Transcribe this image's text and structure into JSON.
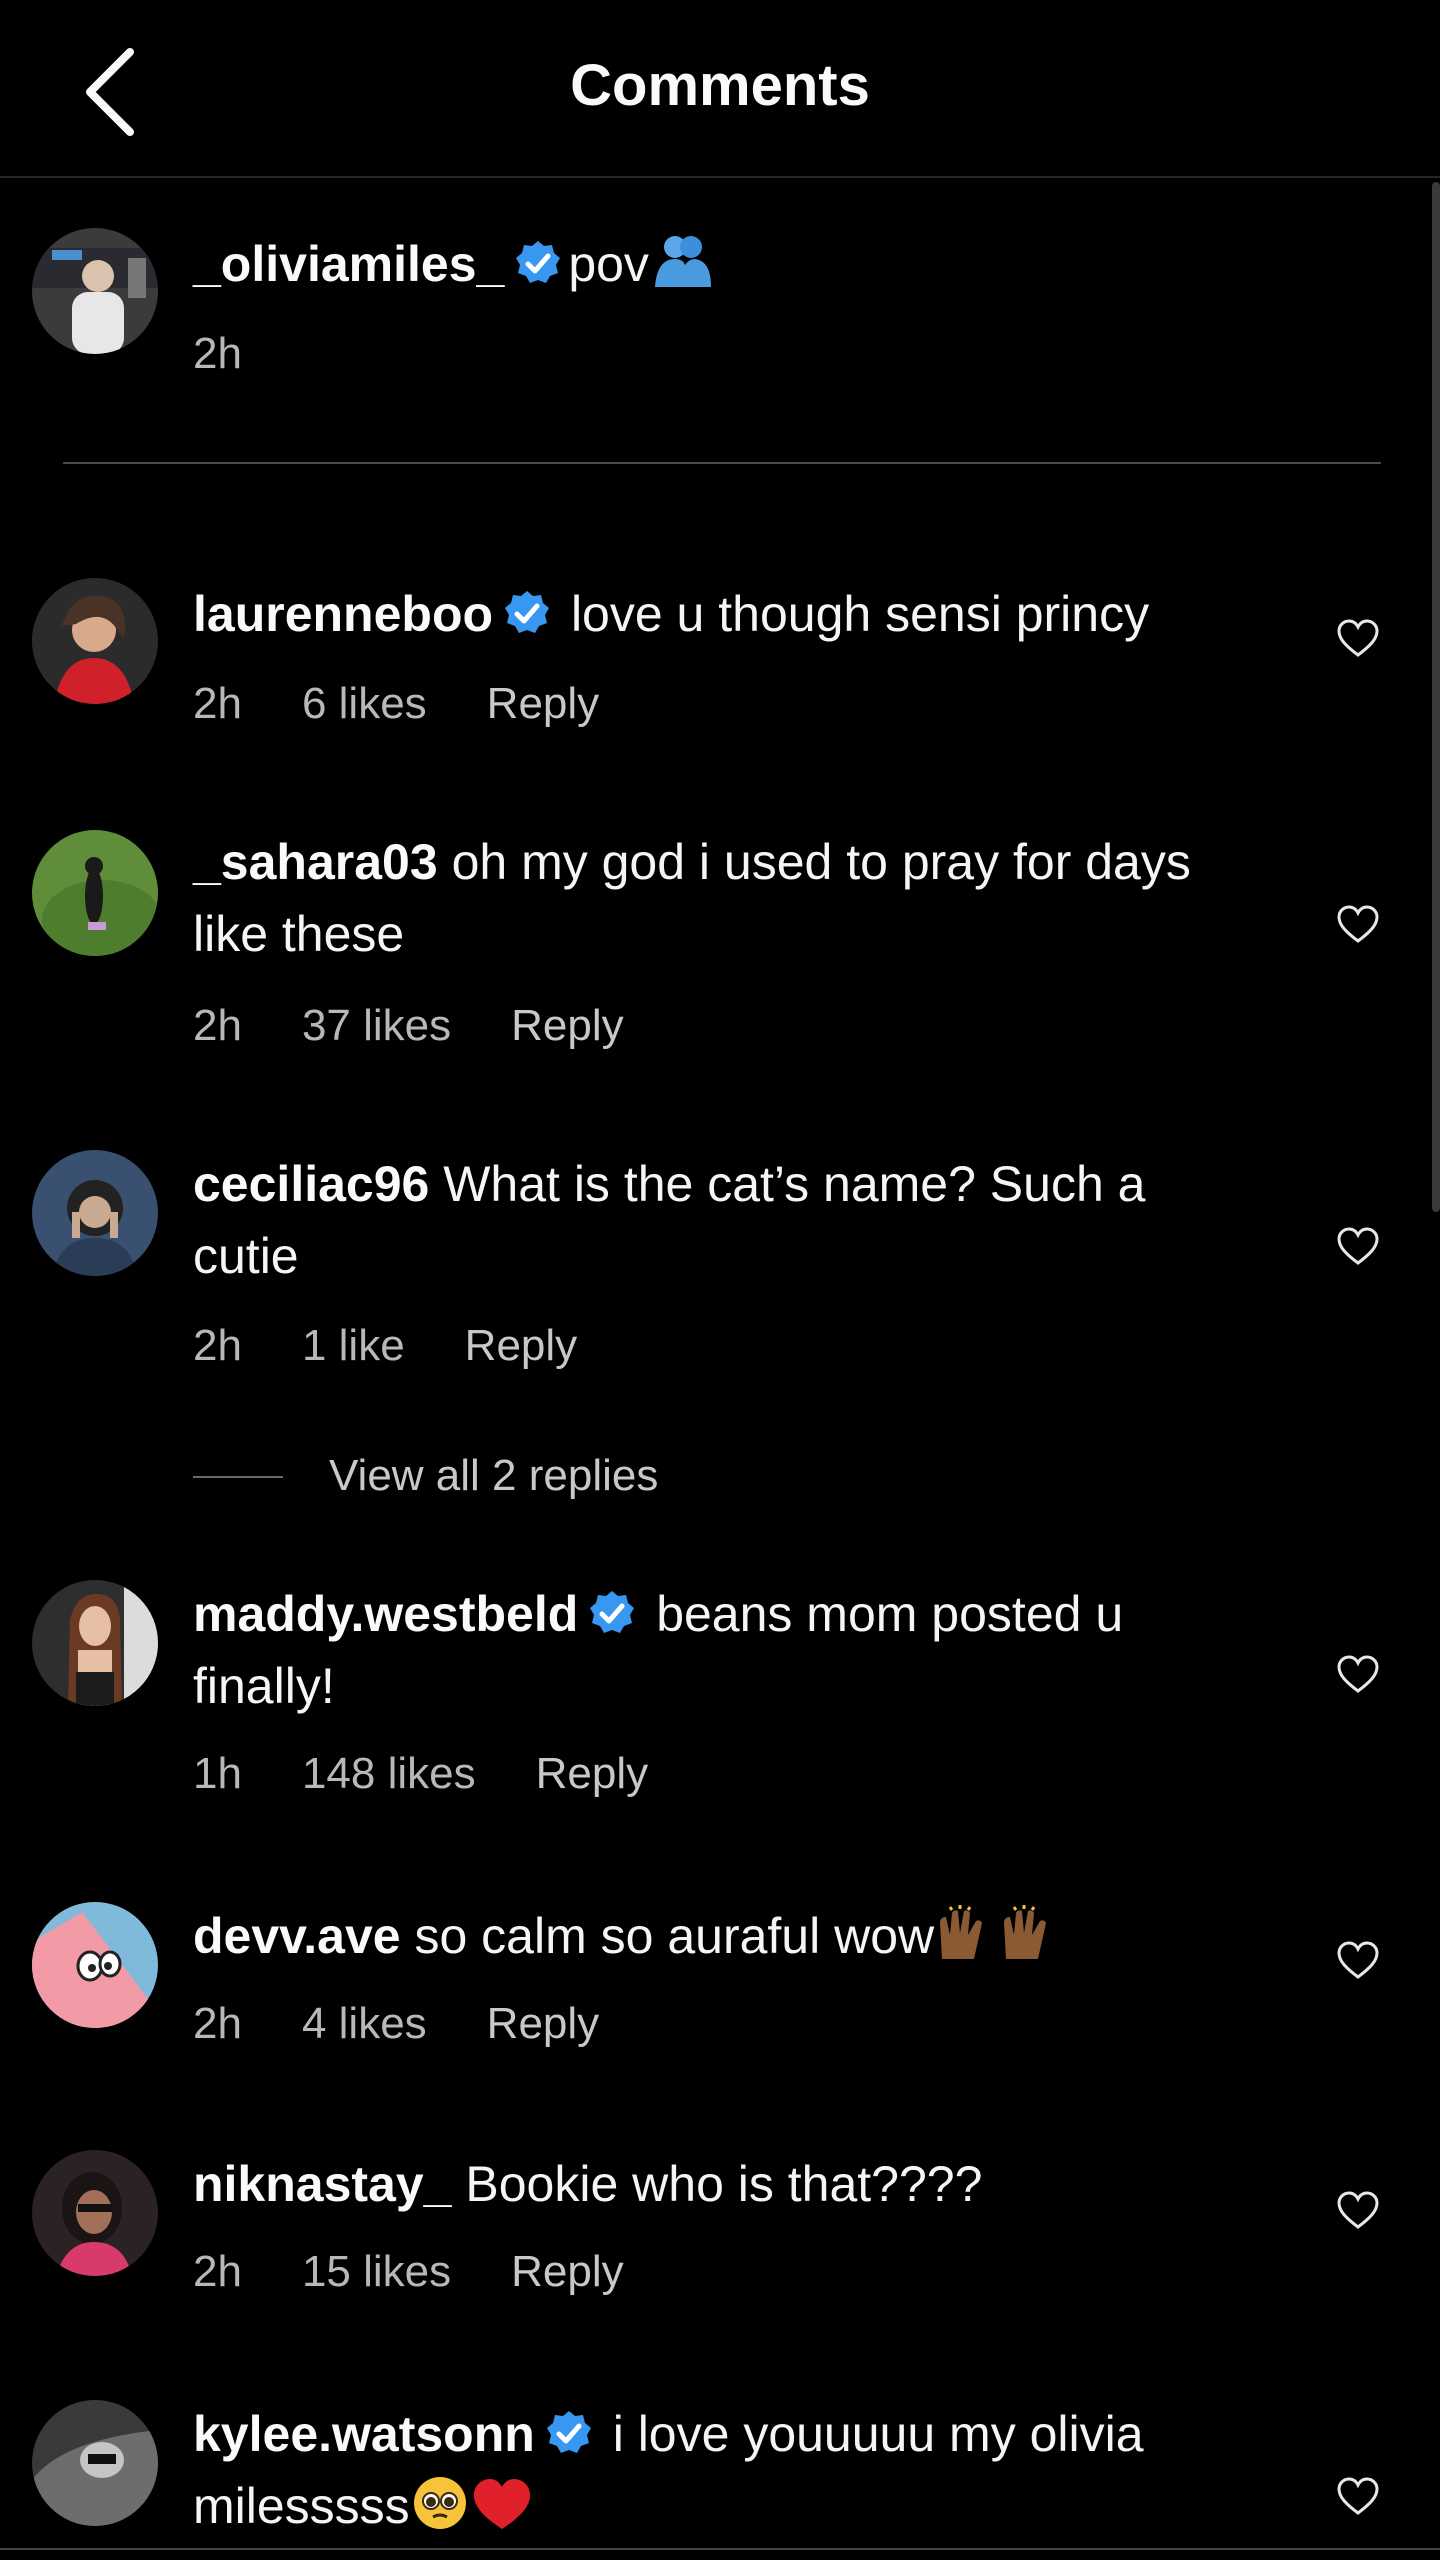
{
  "header": {
    "title": "Comments",
    "back_icon": "chevron-left-icon"
  },
  "caption": {
    "username": "_oliviamiles_",
    "verified": true,
    "text": "pov",
    "emoji_icon": "blue-hug-emoji",
    "time": "2h"
  },
  "comments": [
    {
      "username": "laurenneboo",
      "verified": true,
      "text": "love u though sensi princy",
      "time": "2h",
      "likes": "6 likes",
      "reply": "Reply"
    },
    {
      "username": "_sahara03",
      "verified": false,
      "text": "oh my god i used to pray for days like these",
      "time": "2h",
      "likes": "37 likes",
      "reply": "Reply"
    },
    {
      "username": "ceciliac96",
      "verified": false,
      "text": "What is the cat’s name? Such a cutie",
      "time": "2h",
      "likes": "1 like",
      "reply": "Reply",
      "view_replies": "View all 2 replies"
    },
    {
      "username": "maddy.westbeld",
      "verified": true,
      "text": "beans mom posted u finally!",
      "time": "1h",
      "likes": "148 likes",
      "reply": "Reply"
    },
    {
      "username": "devv.ave",
      "verified": false,
      "text": "so calm so auraful wow",
      "emoji_icon": "raised-hands-emoji-x2",
      "time": "2h",
      "likes": "4 likes",
      "reply": "Reply"
    },
    {
      "username": "niknastay_",
      "verified": false,
      "text": "Bookie who is that????",
      "time": "2h",
      "likes": "15 likes",
      "reply": "Reply"
    },
    {
      "username": "kylee.watsonn",
      "verified": true,
      "text": "i love youuuuu my olivia milesssss",
      "emoji_icon": "pleading-face-and-red-heart-emoji"
    }
  ],
  "colors": {
    "background": "#000000",
    "text": "#f5f5f5",
    "meta": "#b8b8b8",
    "verified": "#3897f0",
    "heart_red": "#e0202a"
  }
}
